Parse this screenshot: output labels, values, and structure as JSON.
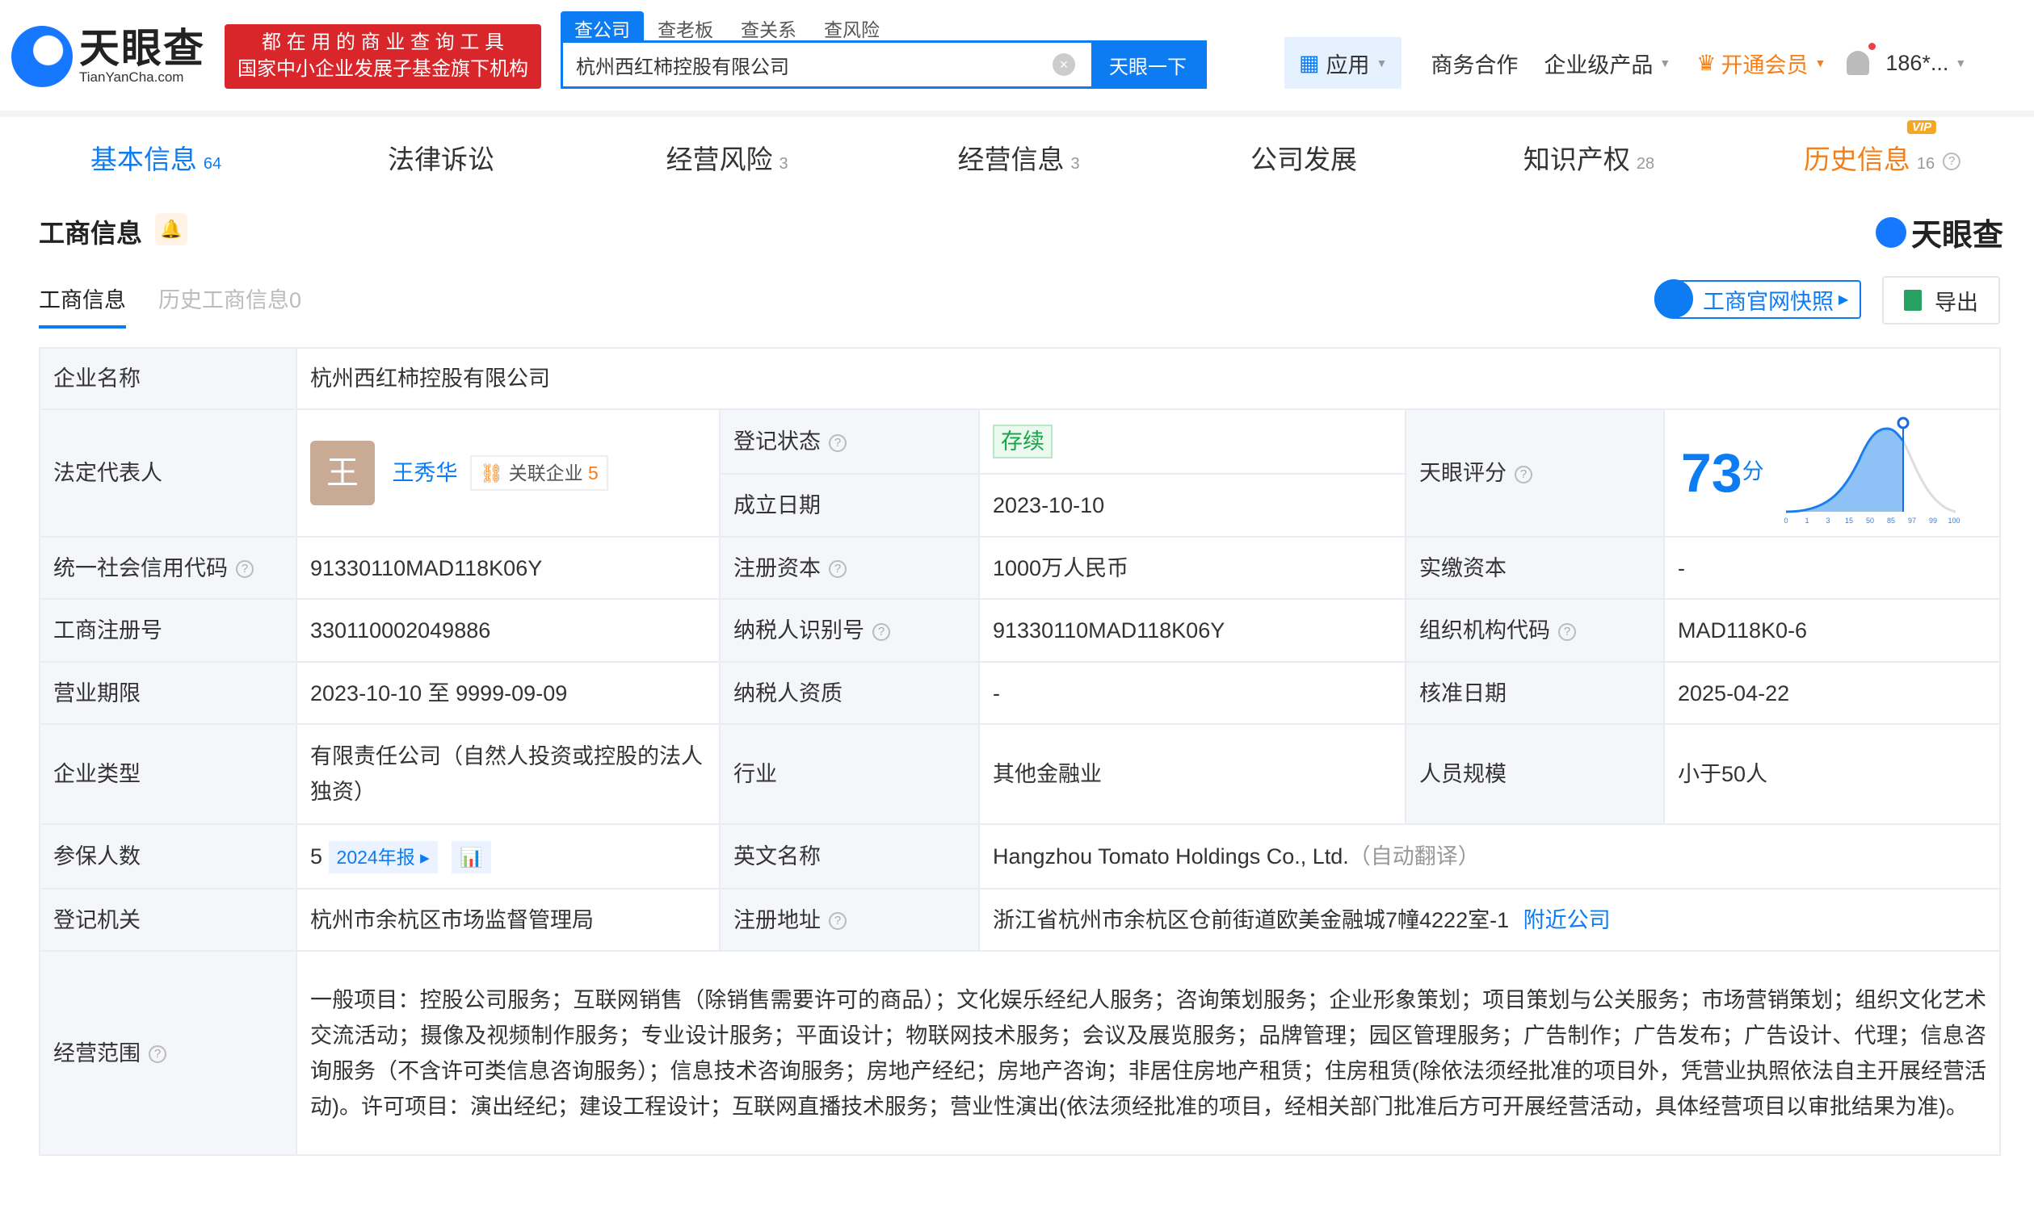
{
  "header": {
    "logo_cn": "天眼查",
    "logo_en": "TianYanCha.com",
    "slogan_line1": "都 在 用 的 商 业 查 询 工 具",
    "slogan_line2": "国家中小企业发展子基金旗下机构",
    "search_tabs": [
      "查公司",
      "查老板",
      "查关系",
      "查风险"
    ],
    "search_value": "杭州西红柿控股有限公司",
    "search_button": "天眼一下",
    "nav": {
      "apps": "应用",
      "business": "商务合作",
      "enterprise": "企业级产品",
      "vip": "开通会员",
      "user": "186*..."
    }
  },
  "tabs": [
    {
      "label": "基本信息",
      "count": "64"
    },
    {
      "label": "法律诉讼",
      "count": ""
    },
    {
      "label": "经营风险",
      "count": "3"
    },
    {
      "label": "经营信息",
      "count": "3"
    },
    {
      "label": "公司发展",
      "count": ""
    },
    {
      "label": "知识产权",
      "count": "28"
    },
    {
      "label": "历史信息",
      "count": "16",
      "badge": "VIP"
    }
  ],
  "section": {
    "title": "工商信息",
    "logo": "天眼查",
    "subtabs": [
      "工商信息",
      "历史工商信息0"
    ],
    "snapshot": "工商官网快照",
    "export": "导出"
  },
  "info": {
    "name_label": "企业名称",
    "name": "杭州西红柿控股有限公司",
    "legal_label": "法定代表人",
    "legal_avatar": "王",
    "legal_name": "王秀华",
    "related_label": "关联企业",
    "related_count": "5",
    "reg_status_label": "登记状态",
    "reg_status": "存续",
    "found_label": "成立日期",
    "found": "2023-10-10",
    "score_label": "天眼评分",
    "score": "73",
    "score_unit": "分",
    "score_ticks": [
      "0",
      "1",
      "3",
      "15",
      "50",
      "85",
      "97",
      "99",
      "100"
    ],
    "credit_label": "统一社会信用代码",
    "credit": "91330110MAD118K06Y",
    "capital_label": "注册资本",
    "capital": "1000万人民币",
    "paid_label": "实缴资本",
    "paid": "-",
    "regno_label": "工商注册号",
    "regno": "330110002049886",
    "taxid_label": "纳税人识别号",
    "taxid": "91330110MAD118K06Y",
    "org_label": "组织机构代码",
    "org": "MAD118K0-6",
    "term_label": "营业期限",
    "term": "2023-10-10 至 9999-09-09",
    "taxq_label": "纳税人资质",
    "taxq": "-",
    "approve_label": "核准日期",
    "approve": "2025-04-22",
    "type_label": "企业类型",
    "type": "有限责任公司（自然人投资或控股的法人独资）",
    "industry_label": "行业",
    "industry": "其他金融业",
    "size_label": "人员规模",
    "size": "小于50人",
    "insured_label": "参保人数",
    "insured": "5",
    "insured_report": "2024年报",
    "en_label": "英文名称",
    "en": "Hangzhou Tomato Holdings Co., Ltd.",
    "en_note": "（自动翻译）",
    "authority_label": "登记机关",
    "authority": "杭州市余杭区市场监督管理局",
    "addr_label": "注册地址",
    "addr": "浙江省杭州市余杭区仓前街道欧美金融城7幢4222室-1",
    "nearby": "附近公司",
    "scope_label": "经营范围",
    "scope": "一般项目：控股公司服务；互联网销售（除销售需要许可的商品）；文化娱乐经纪人服务；咨询策划服务；企业形象策划；项目策划与公关服务；市场营销策划；组织文化艺术交流活动；摄像及视频制作服务；专业设计服务；平面设计；物联网技术服务；会议及展览服务；品牌管理；园区管理服务；广告制作；广告发布；广告设计、代理；信息咨询服务（不含许可类信息咨询服务）；信息技术咨询服务；房地产经纪；房地产咨询；非居住房地产租赁；住房租赁(除依法须经批准的项目外，凭营业执照依法自主开展经营活动)。许可项目：演出经纪；建设工程设计；互联网直播技术服务；营业性演出(依法须经批准的项目，经相关部门批准后方可开展经营活动，具体经营项目以审批结果为准)。"
  }
}
